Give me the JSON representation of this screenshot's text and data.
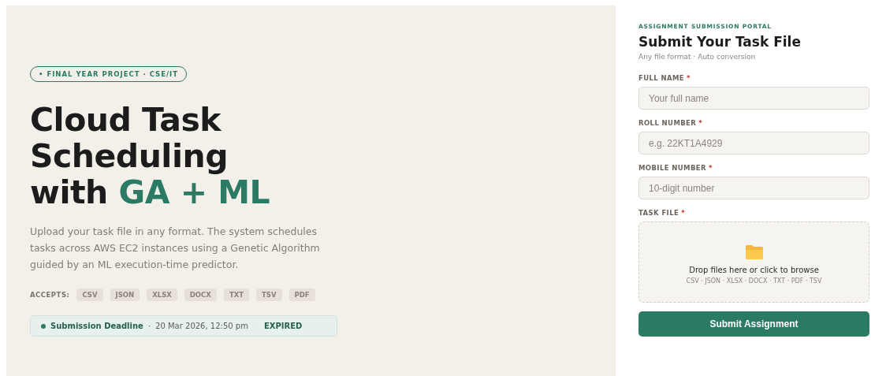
{
  "hero": {
    "badge": "• FINAL YEAR PROJECT · CSE/IT",
    "title_lines": [
      "Cloud Task",
      "Scheduling"
    ],
    "title_last": "with",
    "title_accent": "GA + ML",
    "description": "Upload your task file in any format. The system schedules tasks across AWS EC2 instances using a Genetic Algorithm guided by an ML execution-time predictor.",
    "accepts_label": "ACCEPTS:",
    "formats": [
      "CSV",
      "JSON",
      "XLSX",
      "DOCX",
      "TXT",
      "TSV",
      "PDF"
    ],
    "deadline": {
      "label": "Submission Deadline",
      "separator": "·",
      "date": "20 Mar 2026, 12:50 pm",
      "status": "EXPIRED",
      "color": "#2a7a64"
    }
  },
  "form": {
    "eyebrow": "ASSIGNMENT SUBMISSION PORTAL",
    "title": "Submit Your Task File",
    "subtitle": "Any file format · Auto conversion",
    "fields": [
      {
        "kind": "text",
        "label": "FULL NAME",
        "marker": "*",
        "placeholder": "Your full name"
      },
      {
        "kind": "text",
        "label": "ROLL NUMBER",
        "marker": "*",
        "placeholder": "e.g. 22KT1A4929"
      },
      {
        "kind": "text",
        "label": "MOBILE NUMBER",
        "marker": "*",
        "placeholder": "10-digit number"
      },
      {
        "kind": "file",
        "label": "TASK FILE",
        "marker": "*",
        "prompt": "Drop files here or click to browse",
        "formats": "CSV · JSON · XLSX · DOCX · TXT · PDF · TSV"
      }
    ],
    "submit": "Submit Assignment"
  }
}
